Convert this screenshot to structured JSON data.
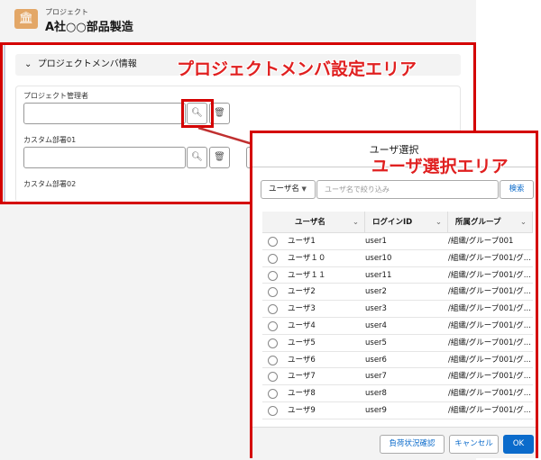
{
  "header": {
    "object_label": "プロジェクト",
    "title": "A社○○部品製造",
    "icon": "bank-icon"
  },
  "section": {
    "title": "プロジェクトメンバ情報"
  },
  "fields": [
    {
      "label": "プロジェクト管理者",
      "value": ""
    },
    {
      "label": "カスタム部署01",
      "value": ""
    },
    {
      "label": "カスタム部署02"
    }
  ],
  "annotations": {
    "member_area": "プロジェクトメンバ設定エリア",
    "user_area": "ユーザ選択エリア",
    "annotation_color": "#d40000"
  },
  "modal": {
    "title": "ユーザ選択",
    "filter_field": "ユーザ名",
    "filter_placeholder": "ユーザ名で絞り込み",
    "search_label": "検索",
    "columns": [
      "ユーザ名",
      "ログインID",
      "所属グループ"
    ],
    "rows": [
      {
        "name": "ユーザ1",
        "login": "user1",
        "group": "/組織/グループ001"
      },
      {
        "name": "ユーザ１０",
        "login": "user10",
        "group": "/組織/グループ001/グ..."
      },
      {
        "name": "ユーザ１１",
        "login": "user11",
        "group": "/組織/グループ001/グ..."
      },
      {
        "name": "ユーザ2",
        "login": "user2",
        "group": "/組織/グループ001/グ..."
      },
      {
        "name": "ユーザ3",
        "login": "user3",
        "group": "/組織/グループ001/グ..."
      },
      {
        "name": "ユーザ4",
        "login": "user4",
        "group": "/組織/グループ001/グ..."
      },
      {
        "name": "ユーザ5",
        "login": "user5",
        "group": "/組織/グループ001/グ..."
      },
      {
        "name": "ユーザ6",
        "login": "user6",
        "group": "/組織/グループ001/グ..."
      },
      {
        "name": "ユーザ7",
        "login": "user7",
        "group": "/組織/グループ001/グ..."
      },
      {
        "name": "ユーザ8",
        "login": "user8",
        "group": "/組織/グループ001/グ..."
      },
      {
        "name": "ユーザ9",
        "login": "user9",
        "group": "/組織/グループ001/グ..."
      }
    ],
    "buttons": {
      "load_check": "負荷状況確認",
      "cancel": "キャンセル",
      "ok": "OK"
    },
    "accent": "#0b6bcb"
  }
}
